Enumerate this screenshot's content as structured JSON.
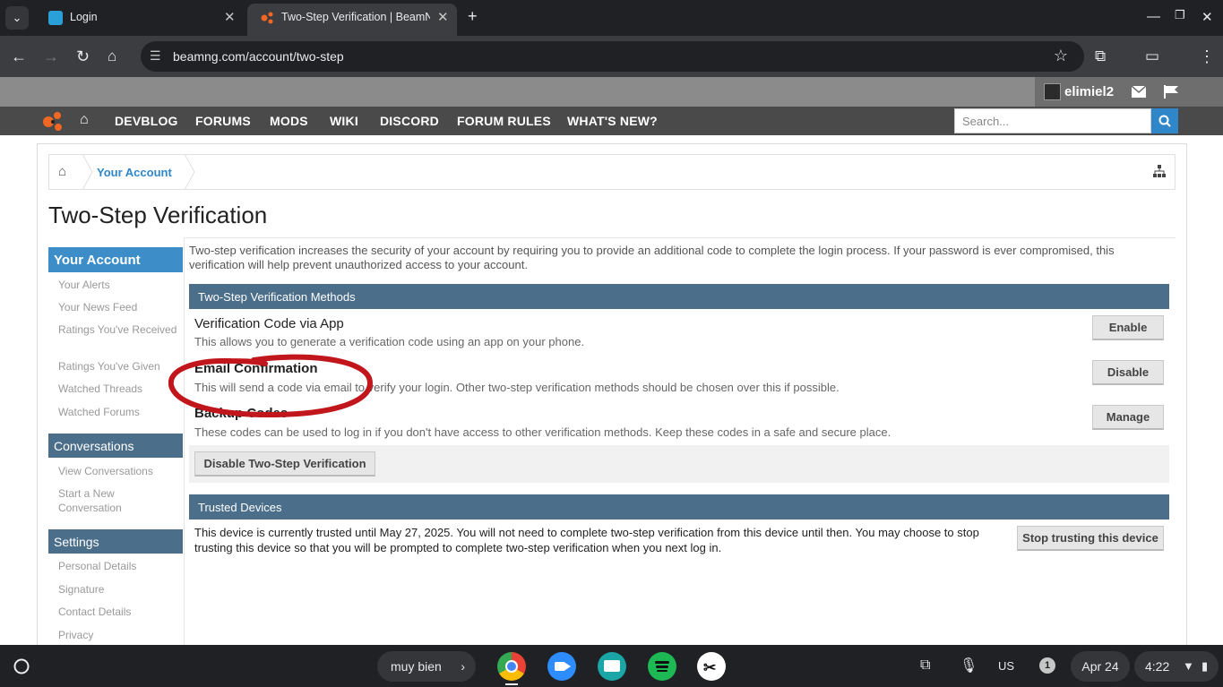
{
  "browser": {
    "tabs": [
      {
        "title": "Login"
      },
      {
        "title": "Two-Step Verification | BeamNG"
      }
    ],
    "url": "beamng.com/account/two-step"
  },
  "site": {
    "username": "elimiel2",
    "nav": [
      "DEVBLOG",
      "FORUMS",
      "MODS",
      "WIKI",
      "DISCORD",
      "FORUM RULES",
      "WHAT'S NEW?"
    ],
    "search_placeholder": "Search...",
    "breadcrumb": "Your Account",
    "page_title": "Two-Step Verification"
  },
  "sidebar": {
    "account_heading": "Your Account",
    "account_items": [
      "Your Alerts",
      "Your News Feed",
      "Ratings You've Received",
      "Ratings You've Given",
      "Watched Threads",
      "Watched Forums"
    ],
    "conversations_heading": "Conversations",
    "conversation_items": [
      "View Conversations",
      "Start a New Conversation"
    ],
    "settings_heading": "Settings",
    "settings_items": [
      "Personal Details",
      "Signature",
      "Contact Details",
      "Privacy"
    ]
  },
  "main": {
    "intro": "Two-step verification increases the security of your account by requiring you to provide an additional code to complete the login process. If your password is ever compromised, this verification will help prevent unauthorized access to your account.",
    "methods_heading": "Two-Step Verification Methods",
    "methods": [
      {
        "title": "Verification Code via App",
        "desc": "This allows you to generate a verification code using an app on your phone.",
        "button": "Enable"
      },
      {
        "title": "Email Confirmation",
        "desc": "This will send a code via email to verify your login. Other two-step verification methods should be chosen over this if possible.",
        "button": "Disable"
      },
      {
        "title": "Backup Codes",
        "desc": "These codes can be used to log in if you don't have access to other verification methods. Keep these codes in a safe and secure place.",
        "button": "Manage"
      }
    ],
    "disable_button": "Disable Two-Step Verification",
    "trusted_heading": "Trusted Devices",
    "trusted_text": "This device is currently trusted until May 27, 2025. You will not need to complete two-step verification from this device until then. You may choose to stop trusting this device so that you will be prompted to complete two-step verification when you next log in.",
    "stop_trust_button": "Stop trusting this device"
  },
  "taskbar": {
    "holding_space": "muy bien",
    "keyboard": "US",
    "notification_count": "1",
    "date": "Apr 24",
    "time": "4:22"
  },
  "colors": {
    "accent": "#2f86c9",
    "section_header": "#4b6e8a",
    "annotation": "#c0161c"
  }
}
